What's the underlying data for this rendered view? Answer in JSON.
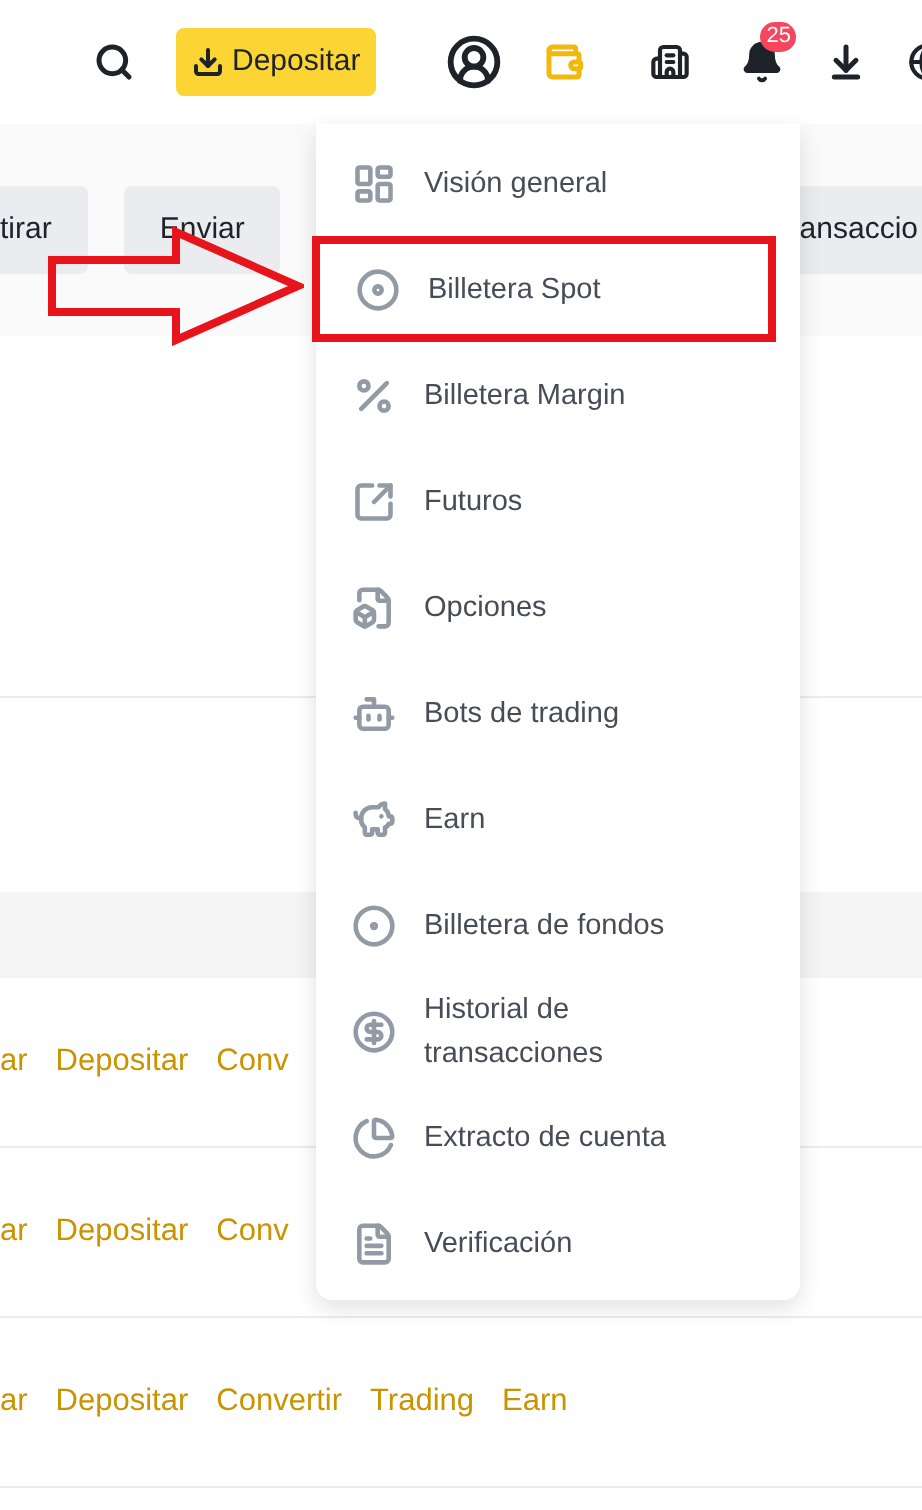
{
  "header": {
    "deposit_button": "Depositar",
    "notification_count": "25"
  },
  "action_tabs": [
    "tirar",
    "Enviar",
    "ansaccio"
  ],
  "rows": [
    {
      "actions": [
        "ar",
        "Depositar",
        "Conv"
      ]
    },
    {
      "actions": [
        "ar",
        "Depositar",
        "Conv"
      ]
    },
    {
      "actions": [
        "ar",
        "Depositar",
        "Convertir",
        "Trading",
        "Earn"
      ]
    }
  ],
  "menu": {
    "items": [
      {
        "label": "Visión general",
        "highlighted": false
      },
      {
        "label": "Billetera Spot",
        "highlighted": true
      },
      {
        "label": "Billetera Margin",
        "highlighted": false
      },
      {
        "label": "Futuros",
        "highlighted": false
      },
      {
        "label": "Opciones",
        "highlighted": false
      },
      {
        "label": "Bots de trading",
        "highlighted": false
      },
      {
        "label": "Earn",
        "highlighted": false
      },
      {
        "label": "Billetera de fondos",
        "highlighted": false
      },
      {
        "label": "Historial de transacciones",
        "highlighted": false
      },
      {
        "label": "Extracto de cuenta",
        "highlighted": false
      },
      {
        "label": "Verificación",
        "highlighted": false
      }
    ]
  }
}
